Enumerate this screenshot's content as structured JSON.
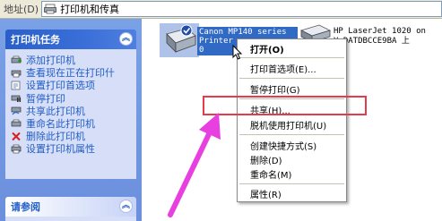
{
  "address_bar": {
    "label": "地址(D)",
    "path": "打印机和传真"
  },
  "task_pane": {
    "printer_tasks": {
      "title": "打印机任务",
      "items": [
        {
          "label": "添加打印机",
          "icon": "add-printer-icon"
        },
        {
          "label": "查看现在正在打印什",
          "icon": "view-queue-icon"
        },
        {
          "label": "设置打印首选项",
          "icon": "preferences-icon"
        },
        {
          "label": "暂停打印",
          "icon": "pause-icon"
        },
        {
          "label": "共享此打印机",
          "icon": "share-icon"
        },
        {
          "label": "重命名此打印机",
          "icon": "rename-icon"
        },
        {
          "label": "删除此打印机",
          "icon": "delete-icon"
        },
        {
          "label": "设置打印机属性",
          "icon": "properties-icon"
        }
      ]
    },
    "see_also": {
      "title": "请参阅"
    }
  },
  "printers": [
    {
      "name_line1": "Canon MP140 series",
      "name_line2": "Printer",
      "count": "0",
      "selected": true
    },
    {
      "name_line1": "HP LaserJet 1020 on",
      "name_line2": "Y-DATDBCCE9BA 上",
      "selected": false
    }
  ],
  "context_menu": {
    "items": [
      {
        "label": "打开(O)",
        "bold": true
      },
      {
        "label": "打印首选项(E)..."
      },
      {
        "label": "暂停打印(G)"
      },
      {
        "label": "共享(H)..."
      },
      {
        "label": "脱机使用打印机(U)"
      },
      {
        "label": "创建快捷方式(S)"
      },
      {
        "label": "删除(D)"
      },
      {
        "label": "重命名(M)"
      },
      {
        "label": "属性(R)"
      }
    ]
  },
  "colors": {
    "highlight_box": "#e53b4a",
    "arrow": "#e83fe0",
    "selection": "#316ac5"
  }
}
